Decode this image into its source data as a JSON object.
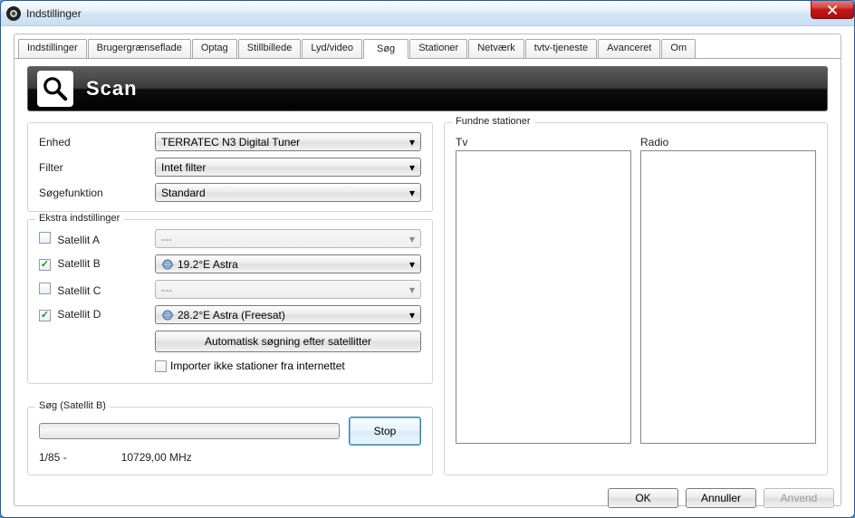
{
  "window": {
    "title": "Indstillinger"
  },
  "tabs": {
    "items": [
      {
        "label": "Indstillinger"
      },
      {
        "label": "Brugergrænseflade"
      },
      {
        "label": "Optag"
      },
      {
        "label": "Stillbillede"
      },
      {
        "label": "Lyd/video"
      },
      {
        "label": "Søg"
      },
      {
        "label": "Stationer"
      },
      {
        "label": "Netværk"
      },
      {
        "label": "tvtv-tjeneste"
      },
      {
        "label": "Avanceret"
      },
      {
        "label": "Om"
      }
    ],
    "active_index": 5
  },
  "header": {
    "title": "Scan"
  },
  "form": {
    "enhed_label": "Enhed",
    "enhed_value": "TERRATEC N3 Digital Tuner",
    "filter_label": "Filter",
    "filter_value": "Intet filter",
    "soge_label": "Søgefunktion",
    "soge_value": "Standard"
  },
  "ekstra": {
    "legend": "Ekstra indstillinger",
    "sat_a_label": "Satellit A",
    "sat_a_checked": false,
    "sat_a_value": "---",
    "sat_b_label": "Satellit B",
    "sat_b_checked": true,
    "sat_b_value": "19.2°E Astra",
    "sat_c_label": "Satellit C",
    "sat_c_checked": false,
    "sat_c_value": "---",
    "sat_d_label": "Satellit D",
    "sat_d_checked": true,
    "sat_d_value": "28.2°E Astra (Freesat)",
    "auto_search_label": "Automatisk søgning efter satellitter",
    "import_checked": false,
    "import_label": "Importer ikke stationer fra internettet"
  },
  "search": {
    "legend": "Søg (Satellit B)",
    "counter": "1/85 -",
    "freq": "10729,00 MHz",
    "stop_label": "Stop"
  },
  "found": {
    "legend": "Fundne stationer",
    "tv_label": "Tv",
    "radio_label": "Radio"
  },
  "buttons": {
    "ok": "OK",
    "cancel": "Annuller",
    "apply": "Anvend"
  }
}
